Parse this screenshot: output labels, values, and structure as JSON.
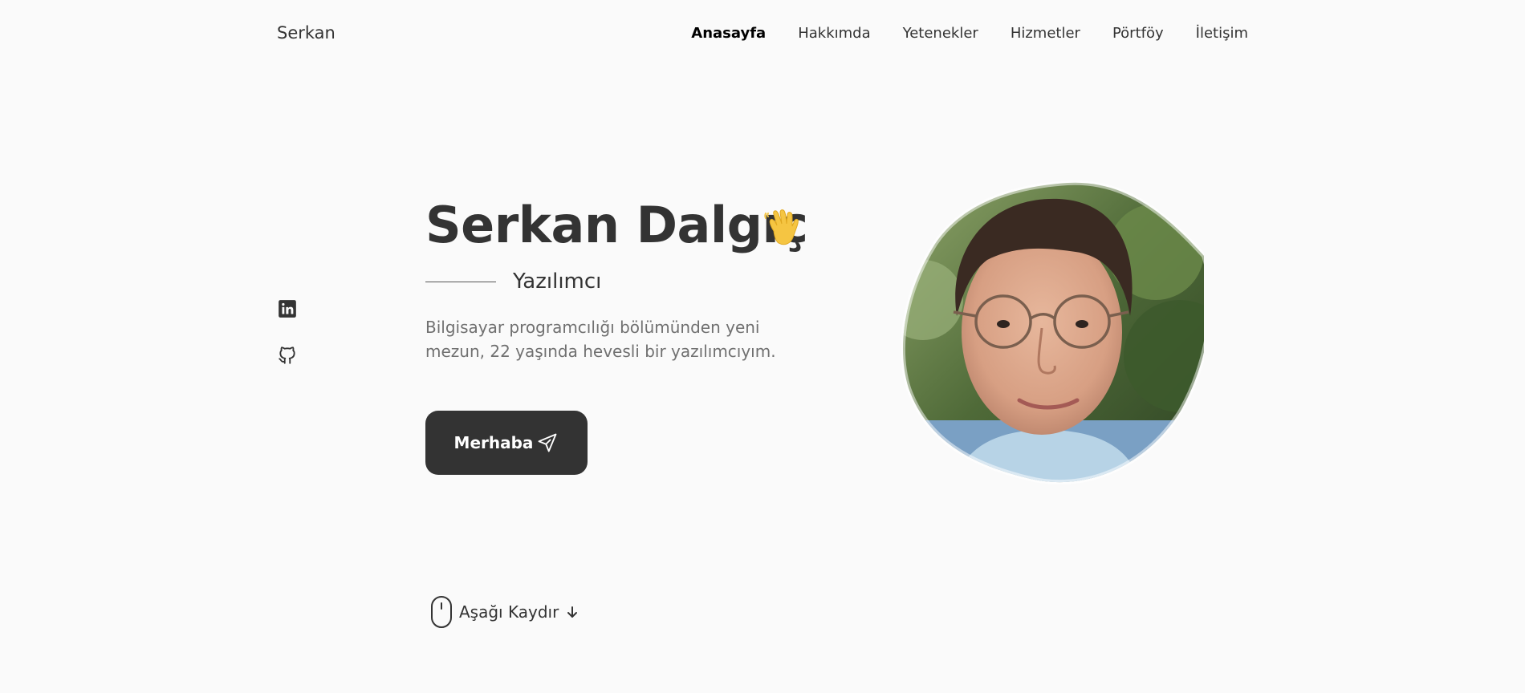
{
  "header": {
    "logo": "Serkan",
    "nav": [
      {
        "label": "Anasayfa",
        "active": true
      },
      {
        "label": "Hakkımda",
        "active": false
      },
      {
        "label": "Yetenekler",
        "active": false
      },
      {
        "label": "Hizmetler",
        "active": false
      },
      {
        "label": "Pörtföy",
        "active": false
      },
      {
        "label": "İletişim",
        "active": false
      }
    ]
  },
  "social": {
    "items": [
      {
        "icon": "linkedin-icon"
      },
      {
        "icon": "github-icon"
      }
    ]
  },
  "hero": {
    "title": "Serkan Dalgıç",
    "title_icon": "waving-hand-icon",
    "subtitle": "Yazılımcı",
    "description": "Bilgisayar programcılığı bölümünden yeni mezun, 22 yaşında hevesli bir yazılımcıyım.",
    "button_label": "Merhaba",
    "button_icon": "send-icon"
  },
  "scroll": {
    "label": "Aşağı Kaydır",
    "mouse_icon": "mouse-icon",
    "arrow_icon": "arrow-down-icon"
  },
  "colors": {
    "background": "#fafafa",
    "text_dark": "#333333",
    "text_muted": "#707070",
    "button_bg": "#333333",
    "button_text": "#ffffff"
  }
}
